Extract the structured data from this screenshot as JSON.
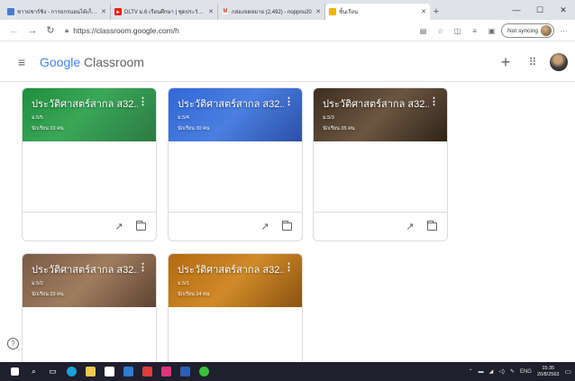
{
  "browser": {
    "tabs": [
      {
        "label": "ชาวบ่ชาร์ชิง - การยกรนอนได้เก็บมินิบ",
        "icon": "page-icon",
        "color": "#4a7bd0",
        "active": false
      },
      {
        "label": "DLTV ม.6 เรียนศึกษา | ชุดประวัติศา",
        "icon": "youtube-icon",
        "color": "#e62117",
        "active": false
      },
      {
        "label": "กล่องจดหมาย (2,492) - noppnu20",
        "icon": "gmail-icon",
        "color": "#d93025",
        "active": false
      },
      {
        "label": "ชั้นเรียน",
        "icon": "classroom-icon",
        "color": "#f4b400",
        "active": true
      }
    ],
    "url": "https://classroom.google.com/h",
    "sync_label": "Not syncing"
  },
  "app": {
    "brand_google": "Google",
    "brand_classroom": "Classroom"
  },
  "courses": [
    {
      "title": "ประวัติศาสตร์สากล ส32...",
      "section": "ม.5/5",
      "students": "นักเรียน 33 คน",
      "theme": "green"
    },
    {
      "title": "ประวัติศาสตร์สากล ส32...",
      "section": "ม.5/4",
      "students": "นักเรียน 30 คน",
      "theme": "blue"
    },
    {
      "title": "ประวัติศาสตร์สากล ส32...",
      "section": "ม.5/3",
      "students": "นักเรียน 35 คน",
      "theme": "brown"
    },
    {
      "title": "ประวัติศาสตร์สากล ส32...",
      "section": "ม.5/2",
      "students": "นักเรียน 33 คน",
      "theme": "sepia"
    },
    {
      "title": "ประวัติศาสตร์สากล ส32...",
      "section": "ม.5/1",
      "students": "นักเรียน 34 คน",
      "theme": "orange"
    }
  ],
  "taskbar": {
    "language": "ENG",
    "time": "15:35",
    "date": "20/8/2563"
  }
}
